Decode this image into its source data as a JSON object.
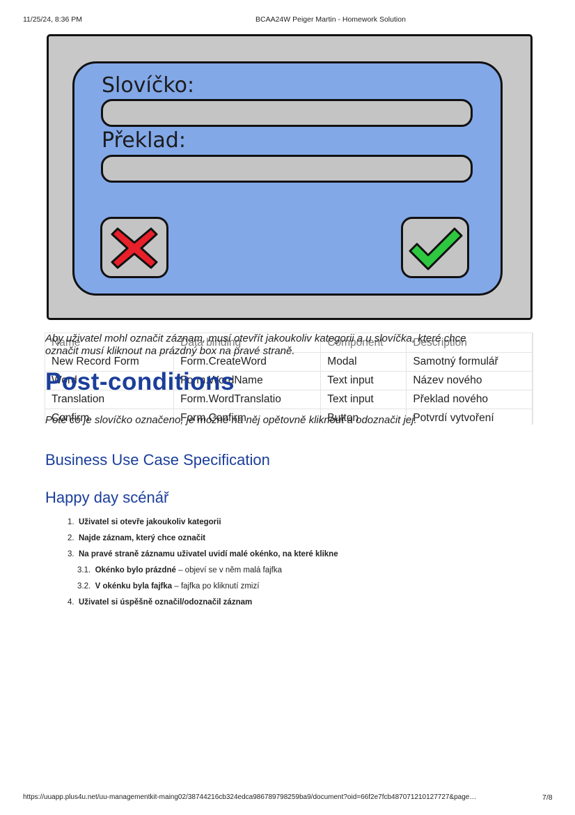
{
  "header": {
    "datetime": "11/25/24, 8:36 PM",
    "doc_title": "BCAA24W Peiger Martin - Homework Solution"
  },
  "mockup": {
    "word_label": "Slovíčko:",
    "translation_label": "Překlad:"
  },
  "paragraphs": {
    "precondition_line1": "Aby uživatel mohl označit záznam, musí otevřít jakoukoliv kategorii a u slovíčka, které chce",
    "precondition_line2": "označit musí kliknout na prázdný box na pravé straně.",
    "postcondition_text": "Poté co je slovíčko označeno, je možné na něj opětovně kliknout a odoznačit jej."
  },
  "post_conditions_heading": "Post-conditions",
  "table": {
    "headers": [
      "Name",
      "Data binding",
      "Component",
      "Description"
    ],
    "rows": [
      [
        "New Record Form",
        "Form.CreateWord",
        "Modal",
        "Samotný formulář"
      ],
      [
        "Word",
        "Form.WordName",
        "Text input",
        "Název nového"
      ],
      [
        "Translation",
        "Form.WordTranslatio",
        "Text input",
        "Překlad nového"
      ],
      [
        "Confirm",
        "Form.Confirm",
        "Button",
        "Potvrdí vytvoření"
      ]
    ]
  },
  "section_title": "Business Use Case Specification",
  "subsection_title": "Happy day scénář",
  "steps": [
    {
      "num": "1.",
      "bold": "Uživatel si otevře jakoukoliv kategorii",
      "rest": ""
    },
    {
      "num": "2.",
      "bold": "Najde záznam, který chce označit",
      "rest": ""
    },
    {
      "num": "3.",
      "bold": "Na pravé straně záznamu uživatel uvidí malé okénko, na které klikne",
      "rest": ""
    },
    {
      "num": "3.1.",
      "bold": "Okénko bylo prázdné",
      "rest": " – objeví se v něm malá fajfka"
    },
    {
      "num": "3.2.",
      "bold": "V okénku byla fajfka",
      "rest": " – fajfka po kliknutí zmizí"
    },
    {
      "num": "4.",
      "bold": "Uživatel si úspěšně označil/odoznačil záznam",
      "rest": ""
    }
  ],
  "footer": {
    "url": "https://uuapp.plus4u.net/uu-managementkit-maing02/38744216cb324edca986789798259ba9/document?oid=66f2e7fcb487071210127727&page…",
    "page": "7/8"
  },
  "colors": {
    "heading": "#1b3e9a",
    "mockup_panel": "#82a8e8",
    "cancel_red": "#e8202a",
    "confirm_green": "#2ec840"
  },
  "icons": [
    "cancel-x-icon",
    "confirm-check-icon"
  ]
}
